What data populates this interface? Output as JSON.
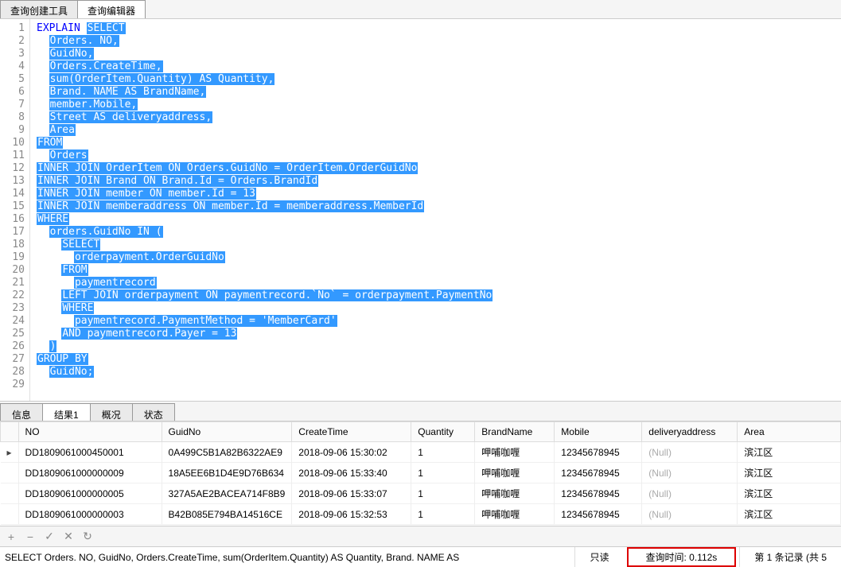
{
  "top_tabs": {
    "creator": "查询创建工具",
    "editor": "查询编辑器"
  },
  "sql": {
    "keyword_explain": "EXPLAIN",
    "lines": [
      {
        "n": 1,
        "pre": "",
        "sel": "SELECT"
      },
      {
        "n": 2,
        "pre": "  ",
        "sel": "Orders. NO,"
      },
      {
        "n": 3,
        "pre": "  ",
        "sel": "GuidNo,"
      },
      {
        "n": 4,
        "pre": "  ",
        "sel": "Orders.CreateTime,"
      },
      {
        "n": 5,
        "pre": "  ",
        "sel": "sum(OrderItem.Quantity) AS Quantity,"
      },
      {
        "n": 6,
        "pre": "  ",
        "sel": "Brand. NAME AS BrandName,"
      },
      {
        "n": 7,
        "pre": "  ",
        "sel": "member.Mobile,"
      },
      {
        "n": 8,
        "pre": "  ",
        "sel": "Street AS deliveryaddress,"
      },
      {
        "n": 9,
        "pre": "  ",
        "sel": "Area"
      },
      {
        "n": 10,
        "pre": "",
        "sel": "FROM"
      },
      {
        "n": 11,
        "pre": "  ",
        "sel": "Orders"
      },
      {
        "n": 12,
        "pre": "",
        "sel": "INNER JOIN OrderItem ON Orders.GuidNo = OrderItem.OrderGuidNo"
      },
      {
        "n": 13,
        "pre": "",
        "sel": "INNER JOIN Brand ON Brand.Id = Orders.BrandId"
      },
      {
        "n": 14,
        "pre": "",
        "sel": "INNER JOIN member ON member.Id = 13"
      },
      {
        "n": 15,
        "pre": "",
        "sel": "INNER JOIN memberaddress ON member.Id = memberaddress.MemberId"
      },
      {
        "n": 16,
        "pre": "",
        "sel": "WHERE"
      },
      {
        "n": 17,
        "pre": "  ",
        "sel": "orders.GuidNo IN (",
        "fold": true
      },
      {
        "n": 18,
        "pre": "    ",
        "sel": "SELECT"
      },
      {
        "n": 19,
        "pre": "      ",
        "sel": "orderpayment.OrderGuidNo"
      },
      {
        "n": 20,
        "pre": "    ",
        "sel": "FROM"
      },
      {
        "n": 21,
        "pre": "      ",
        "sel": "paymentrecord"
      },
      {
        "n": 22,
        "pre": "    ",
        "sel": "LEFT JOIN orderpayment ON paymentrecord.`No` = orderpayment.PaymentNo"
      },
      {
        "n": 23,
        "pre": "    ",
        "sel": "WHERE"
      },
      {
        "n": 24,
        "pre": "      ",
        "sel": "paymentrecord.PaymentMethod = 'MemberCard'"
      },
      {
        "n": 25,
        "pre": "    ",
        "sel": "AND paymentrecord.Payer = 13"
      },
      {
        "n": 26,
        "pre": "  ",
        "sel": ")"
      },
      {
        "n": 27,
        "pre": "",
        "sel": "GROUP BY"
      },
      {
        "n": 28,
        "pre": "  ",
        "sel": "GuidNo;"
      },
      {
        "n": 29,
        "pre": "",
        "sel": ""
      }
    ]
  },
  "result_tabs": {
    "info": "信息",
    "result1": "结果1",
    "profile": "概况",
    "status": "状态"
  },
  "grid": {
    "columns": [
      "NO",
      "GuidNo",
      "CreateTime",
      "Quantity",
      "BrandName",
      "Mobile",
      "deliveryaddress",
      "Area"
    ],
    "rows": [
      {
        "current": true,
        "NO": "DD1809061000450001",
        "GuidNo": "0A499C5B1A82B6322AE9",
        "CreateTime": "2018-09-06 15:30:02",
        "Quantity": "1",
        "BrandName": "呷哺咖喱",
        "Mobile": "12345678945",
        "deliveryaddress": null,
        "Area": "滨江区"
      },
      {
        "current": false,
        "NO": "DD1809061000000009",
        "GuidNo": "18A5EE6B1D4E9D76B634",
        "CreateTime": "2018-09-06 15:33:40",
        "Quantity": "1",
        "BrandName": "呷哺咖喱",
        "Mobile": "12345678945",
        "deliveryaddress": null,
        "Area": "滨江区"
      },
      {
        "current": false,
        "NO": "DD1809061000000005",
        "GuidNo": "327A5AE2BACEA714F8B9",
        "CreateTime": "2018-09-06 15:33:07",
        "Quantity": "1",
        "BrandName": "呷哺咖喱",
        "Mobile": "12345678945",
        "deliveryaddress": null,
        "Area": "滨江区"
      },
      {
        "current": false,
        "NO": "DD1809061000000003",
        "GuidNo": "B42B085E794BA14516CE",
        "CreateTime": "2018-09-06 15:32:53",
        "Quantity": "1",
        "BrandName": "呷哺咖喱",
        "Mobile": "12345678945",
        "deliveryaddress": null,
        "Area": "滨江区"
      }
    ],
    "null_text": "(Null)"
  },
  "toolbar": {
    "add": "+",
    "del": "−",
    "ok": "✓",
    "cancel": "✕",
    "refresh": "↻"
  },
  "status": {
    "sql": "SELECT   Orders. NO,          GuidNo,   Orders.CreateTime,                  sum(OrderItem.Quantity) AS Quantity,   Brand. NAME AS",
    "readonly": "只读",
    "qtime": "查询时间: 0.112s",
    "record": "第 1 条记录 (共 5"
  }
}
